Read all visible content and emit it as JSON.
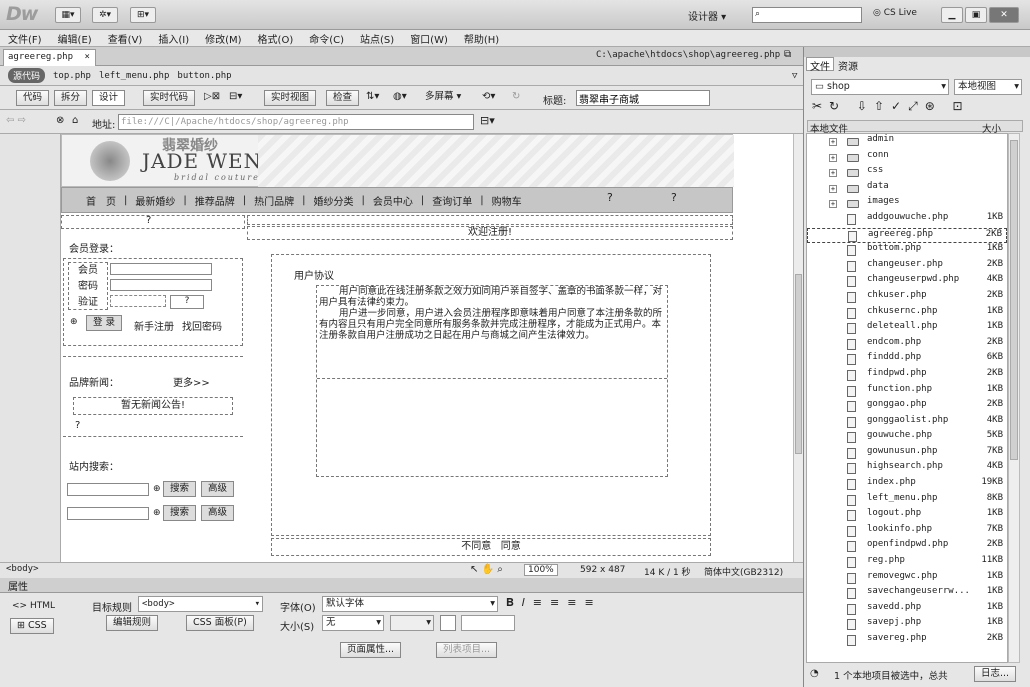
{
  "app": {
    "logo": "Dw",
    "workspace": "设计器",
    "search_placeholder": "",
    "cslive": "CS Live"
  },
  "menu": [
    "文件(F)",
    "编辑(E)",
    "查看(V)",
    "插入(I)",
    "修改(M)",
    "格式(O)",
    "命令(C)",
    "站点(S)",
    "窗口(W)",
    "帮助(H)"
  ],
  "doc": {
    "tab": "agreereg.php",
    "path": "C:\\apache\\htdocs\\shop\\agreereg.php"
  },
  "related": {
    "source": "源代码",
    "files": [
      "top.php",
      "left_menu.php",
      "button.php"
    ]
  },
  "toolbar": {
    "code": "代码",
    "split": "拆分",
    "design": "设计",
    "live_code": "实时代码",
    "live_view": "实时视图",
    "inspect": "检查",
    "multiscreen": "多屏幕",
    "title_label": "标题:",
    "title_value": "翡翠串子商城"
  },
  "address": {
    "label": "地址:",
    "value": "file:///C|/Apache/htdocs/shop/agreereg.php"
  },
  "page": {
    "brand_cn": "翡翠婚纱",
    "brand_en": "JADE WEN",
    "brand_sub": "bridal couture",
    "nav": [
      "首　页",
      "最新婚纱",
      "推荐品牌",
      "热门品牌",
      "婚纱分类",
      "会员中心",
      "查询订单",
      "购物车"
    ],
    "nav_flash": "?",
    "member_login": "会员登录：",
    "member": "会员",
    "password": "密码",
    "verify": "验证",
    "login": "登 录",
    "register": "新手注册",
    "findpwd": "找回密码",
    "brand_news": "品牌新闻：",
    "more": "更多>>",
    "no_notice": "暂无新闻公告!",
    "site_search": "站内搜索：",
    "search": "搜索",
    "advanced": "高级",
    "welcome": "欢迎注册!",
    "agreement_title": "用户协议",
    "agreement_p1": "用户同意此在线注册条款之效力如同用户亲自签字、盖章的书面条款一样，对用户具有法律约束力。",
    "agreement_p2": "用户进一步同意，用户进入会员注册程序即意味着用户同意了本注册条款的所有内容且只有用户完全同意所有服务条款并完成注册程序，才能成为正式用户。本注册条款自用户注册成功之日起在用户与商城之间产生法律效力。",
    "disagree": "不同意",
    "agree": "同意"
  },
  "status": {
    "tag": "<body>",
    "zoom": "100%",
    "size": "592 x 487",
    "kb": "14 K / 1 秒",
    "encoding": "简体中文(GB2312)"
  },
  "props": {
    "title": "属性",
    "html": "HTML",
    "css": "CSS",
    "target_label": "目标规则",
    "target": "<body>",
    "edit_rule": "编辑规则",
    "css_panel": "CSS 面板(P)",
    "font_label": "字体(O)",
    "font": "默认字体",
    "size_label": "大小(S)",
    "size": "无",
    "page_props": "页面属性...",
    "list_item": "列表项目..."
  },
  "panel": {
    "files": "文件",
    "assets": "资源",
    "site": "shop",
    "view": "本地视图",
    "col_name": "本地文件",
    "col_size": "大小",
    "footer": "1 个本地项目被选中，总共",
    "log": "日志..."
  },
  "files": [
    {
      "name": "admin",
      "size": "",
      "folder": true
    },
    {
      "name": "conn",
      "size": "",
      "folder": true
    },
    {
      "name": "css",
      "size": "",
      "folder": true
    },
    {
      "name": "data",
      "size": "",
      "folder": true
    },
    {
      "name": "images",
      "size": "",
      "folder": true
    },
    {
      "name": "addgouwuche.php",
      "size": "1KB"
    },
    {
      "name": "agreereg.php",
      "size": "2KB",
      "selected": true
    },
    {
      "name": "bottom.php",
      "size": "1KB"
    },
    {
      "name": "changeuser.php",
      "size": "2KB"
    },
    {
      "name": "changeuserpwd.php",
      "size": "4KB"
    },
    {
      "name": "chkuser.php",
      "size": "2KB"
    },
    {
      "name": "chkusernc.php",
      "size": "1KB"
    },
    {
      "name": "deleteall.php",
      "size": "1KB"
    },
    {
      "name": "endcom.php",
      "size": "2KB"
    },
    {
      "name": "finddd.php",
      "size": "6KB"
    },
    {
      "name": "findpwd.php",
      "size": "2KB"
    },
    {
      "name": "function.php",
      "size": "1KB"
    },
    {
      "name": "gonggao.php",
      "size": "2KB"
    },
    {
      "name": "gonggaolist.php",
      "size": "4KB"
    },
    {
      "name": "gouwuche.php",
      "size": "5KB"
    },
    {
      "name": "gowunusun.php",
      "size": "7KB"
    },
    {
      "name": "highsearch.php",
      "size": "4KB"
    },
    {
      "name": "index.php",
      "size": "19KB"
    },
    {
      "name": "left_menu.php",
      "size": "8KB"
    },
    {
      "name": "logout.php",
      "size": "1KB"
    },
    {
      "name": "lookinfo.php",
      "size": "7KB"
    },
    {
      "name": "openfindpwd.php",
      "size": "2KB"
    },
    {
      "name": "reg.php",
      "size": "11KB"
    },
    {
      "name": "removegwc.php",
      "size": "1KB"
    },
    {
      "name": "savechangeuserrw...",
      "size": "1KB"
    },
    {
      "name": "savedd.php",
      "size": "1KB"
    },
    {
      "name": "savepj.php",
      "size": "1KB"
    },
    {
      "name": "savereg.php",
      "size": "2KB"
    }
  ]
}
